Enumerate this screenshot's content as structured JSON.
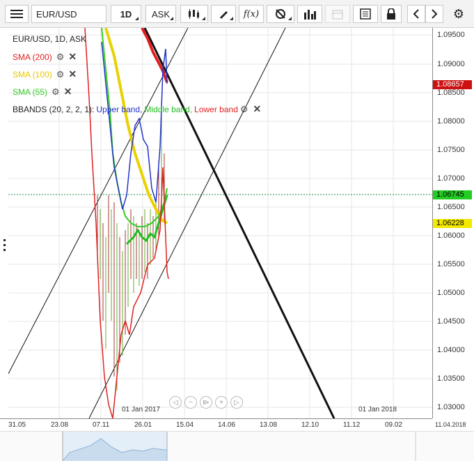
{
  "toolbar": {
    "symbol": "EUR/USD",
    "timeframe": "1D",
    "price_type": "ASK",
    "icons": [
      "menu-icon",
      "candles-icon",
      "pencil-icon",
      "function-icon",
      "clock-icon",
      "volume-bars-icon",
      "calendar-icon",
      "report-icon",
      "lock-icon",
      "chevron-left-icon",
      "chevron-right-icon",
      "gear-icon"
    ]
  },
  "legend": {
    "main": "EUR/USD, 1D, ASK",
    "sma200": "SMA (200)",
    "sma100": "SMA (100)",
    "sma55": "SMA (55)",
    "bbands_prefix": "BBANDS (20, 2, 2, 1):",
    "bb_upper": "Upper band,",
    "bb_middle": "Middle band,",
    "bb_lower": "Lower band"
  },
  "price_axis": {
    "labels": [
      "1.09500",
      "1.09000",
      "1.08500",
      "1.08000",
      "1.07500",
      "1.07000",
      "1.06500",
      "1.06000",
      "1.05500",
      "1.05000",
      "1.04500",
      "1.04000",
      "1.03500",
      "1.03000"
    ],
    "tag_red": "1.08657",
    "tag_green": "1.06745",
    "tag_yellow": "1.06228"
  },
  "time_axis": {
    "labels": [
      "31.05",
      "23.08",
      "07.11",
      "26.01",
      "15.04",
      "14.06",
      "13.08",
      "12.10",
      "11.12",
      "09.02",
      "11.04.2018"
    ]
  },
  "annotations": {
    "jan2017": "01 Jan 2017",
    "jan2018": "01 Jan 2018"
  },
  "colors": {
    "sma200": "#e02020",
    "sma100": "#e8d200",
    "sma55": "#33cc22",
    "bb_upper": "#2233cc",
    "bb_middle": "#22bb22",
    "bb_lower": "#e02020",
    "tag_red": "#cc1111",
    "tag_green": "#22cc22",
    "tag_yellow": "#f2e800"
  }
}
